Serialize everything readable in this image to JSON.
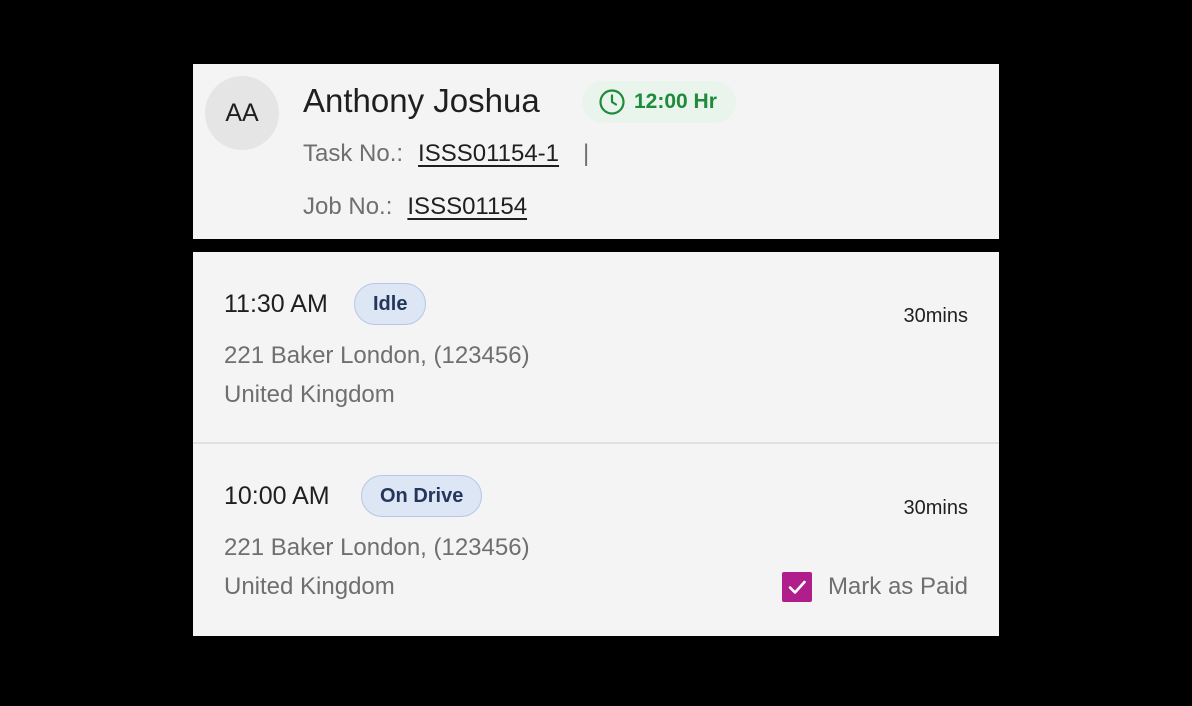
{
  "header": {
    "avatar_initials": "AA",
    "name": "Anthony Joshua",
    "duration": "12:00 Hr",
    "duration_icon": "clock-icon",
    "task_label": "Task No.:",
    "task_value": "ISSS01154-1",
    "separator": "|",
    "job_label": "Job No.:",
    "job_value": "ISSS01154"
  },
  "entries": [
    {
      "time": "11:30 AM",
      "status": "Idle",
      "duration": "30mins",
      "address_line1": "221 Baker London, (123456)",
      "address_line2": "United Kingdom"
    },
    {
      "time": "10:00 AM",
      "status": "On Drive",
      "duration": "30mins",
      "address_line1": "221 Baker London, (123456)",
      "address_line2": "United Kingdom",
      "mark_paid_label": "Mark as Paid",
      "mark_paid_checked": true
    }
  ],
  "colors": {
    "background": "#000000",
    "card": "#f4f4f4",
    "duration_green": "#1f8a3a",
    "status_bg": "#dde6f4",
    "checkbox": "#b01e8c"
  }
}
